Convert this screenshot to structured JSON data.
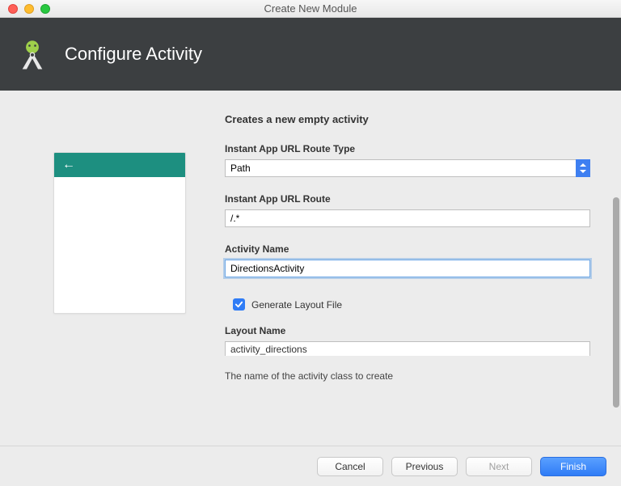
{
  "window": {
    "title": "Create New Module"
  },
  "banner": {
    "title": "Configure Activity"
  },
  "form": {
    "heading": "Creates a new empty activity",
    "route_type": {
      "label": "Instant App URL Route Type",
      "value": "Path"
    },
    "route": {
      "label": "Instant App URL Route",
      "value": "/.*"
    },
    "activity_name": {
      "label": "Activity Name",
      "value": "DirectionsActivity"
    },
    "generate_layout": {
      "label": "Generate Layout File",
      "checked": true
    },
    "layout_name": {
      "label": "Layout Name",
      "value": "activity_directions"
    },
    "hint": "The name of the activity class to create"
  },
  "buttons": {
    "cancel": "Cancel",
    "previous": "Previous",
    "next": "Next",
    "finish": "Finish"
  }
}
